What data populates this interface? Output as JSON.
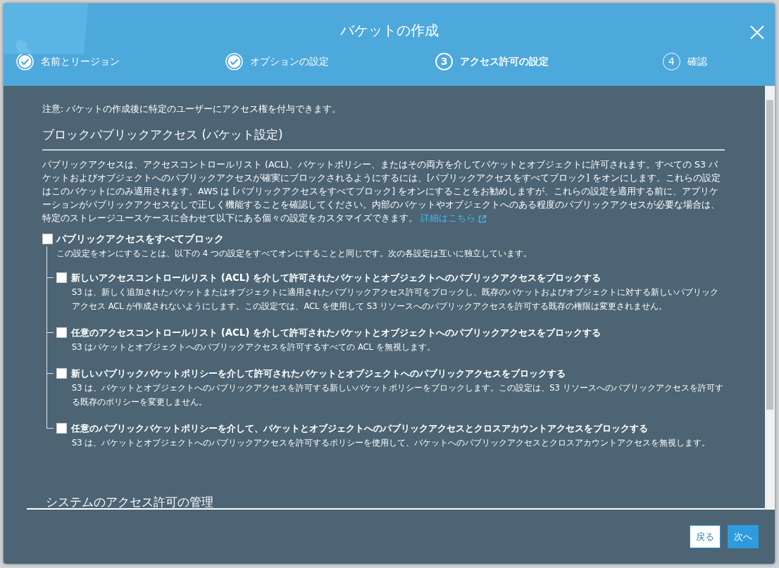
{
  "dialog": {
    "title": "バケットの作成"
  },
  "steps": [
    {
      "label": "名前とリージョン",
      "completed": true,
      "selected": false
    },
    {
      "label": "オプションの設定",
      "completed": true,
      "selected": false
    },
    {
      "label": "アクセス許可の設定",
      "completed": false,
      "selected": true,
      "number": "3"
    },
    {
      "label": "確認",
      "completed": false,
      "selected": false,
      "number": "4"
    }
  ],
  "note": "注意: バケットの作成後に特定のユーザーにアクセス権を付与できます。",
  "section": {
    "heading": "ブロックパブリックアクセス (バケット設定)",
    "description": "パブリックアクセスは、アクセスコントロールリスト (ACL)、バケットポリシー、またはその両方を介してバケットとオブジェクトに許可されます。すべての S3 バケットおよびオブジェクトへのパブリックアクセスが確実にブロックされるようにするには、[パブリックアクセスをすべてブロック] をオンにします。これらの設定はこのバケットにのみ適用されます。AWS は [パブリックアクセスをすべてブロック] をオンにすることをお勧めしますが、これらの設定を適用する前に、アプリケーションがパブリックアクセスなしで正しく機能することを確認してください。内部のバケットやオブジェクトへのある程度のパブリックアクセスが必要な場合は、特定のストレージユースケースに合わせて以下にある個々の設定をカスタマイズできます。",
    "link": "詳細はこちら"
  },
  "block_all": {
    "label": "パブリックアクセスをすべてブロック",
    "checked": false,
    "description": "この設定をオンにすることは、以下の 4 つの設定をすべてオンにすることと同じです。次の各設定は互いに独立しています。",
    "children": [
      {
        "label": "新しいアクセスコントロールリスト (ACL) を介して許可されたバケットとオブジェクトへのパブリックアクセスをブロックする",
        "checked": false,
        "description": "S3 は、新しく追加されたバケットまたはオブジェクトに適用されたパブリックアクセス許可をブロックし、既存のバケットおよびオブジェクトに対する新しいパブリックアクセス ACL が作成されないようにします。この設定では、ACL を使用して S3 リソースへのパブリックアクセスを許可する既存の権限は変更されません。"
      },
      {
        "label": "任意のアクセスコントロールリスト (ACL) を介して許可されたバケットとオブジェクトへのパブリックアクセスをブロックする",
        "checked": false,
        "description": "S3 はバケットとオブジェクトへのパブリックアクセスを許可するすべての ACL を無視します。"
      },
      {
        "label": "新しいパブリックバケットポリシーを介して許可されたバケットとオブジェクトへのパブリックアクセスをブロックする",
        "checked": false,
        "description": "S3 は、バケットとオブジェクトへのパブリックアクセスを許可する新しいバケットポリシーをブロックします。この設定は、S3 リソースへのパブリックアクセスを許可する既存のポリシーを変更しません。"
      },
      {
        "label": "任意のパブリックバケットポリシーを介して、バケットとオブジェクトへのパブリックアクセスとクロスアカウントアクセスをブロックする",
        "checked": false,
        "description": "S3 は、バケットとオブジェクトへのパブリックアクセスを許可するポリシーを使用して、バケットへのパブリックアクセスとクロスアカウントアクセスを無視します。"
      }
    ]
  },
  "next_section": {
    "heading": "システムのアクセス許可の管理"
  },
  "buttons": [
    {
      "label": "戻る",
      "kind": "secondary"
    },
    {
      "label": "次へ",
      "kind": "primary"
    }
  ]
}
